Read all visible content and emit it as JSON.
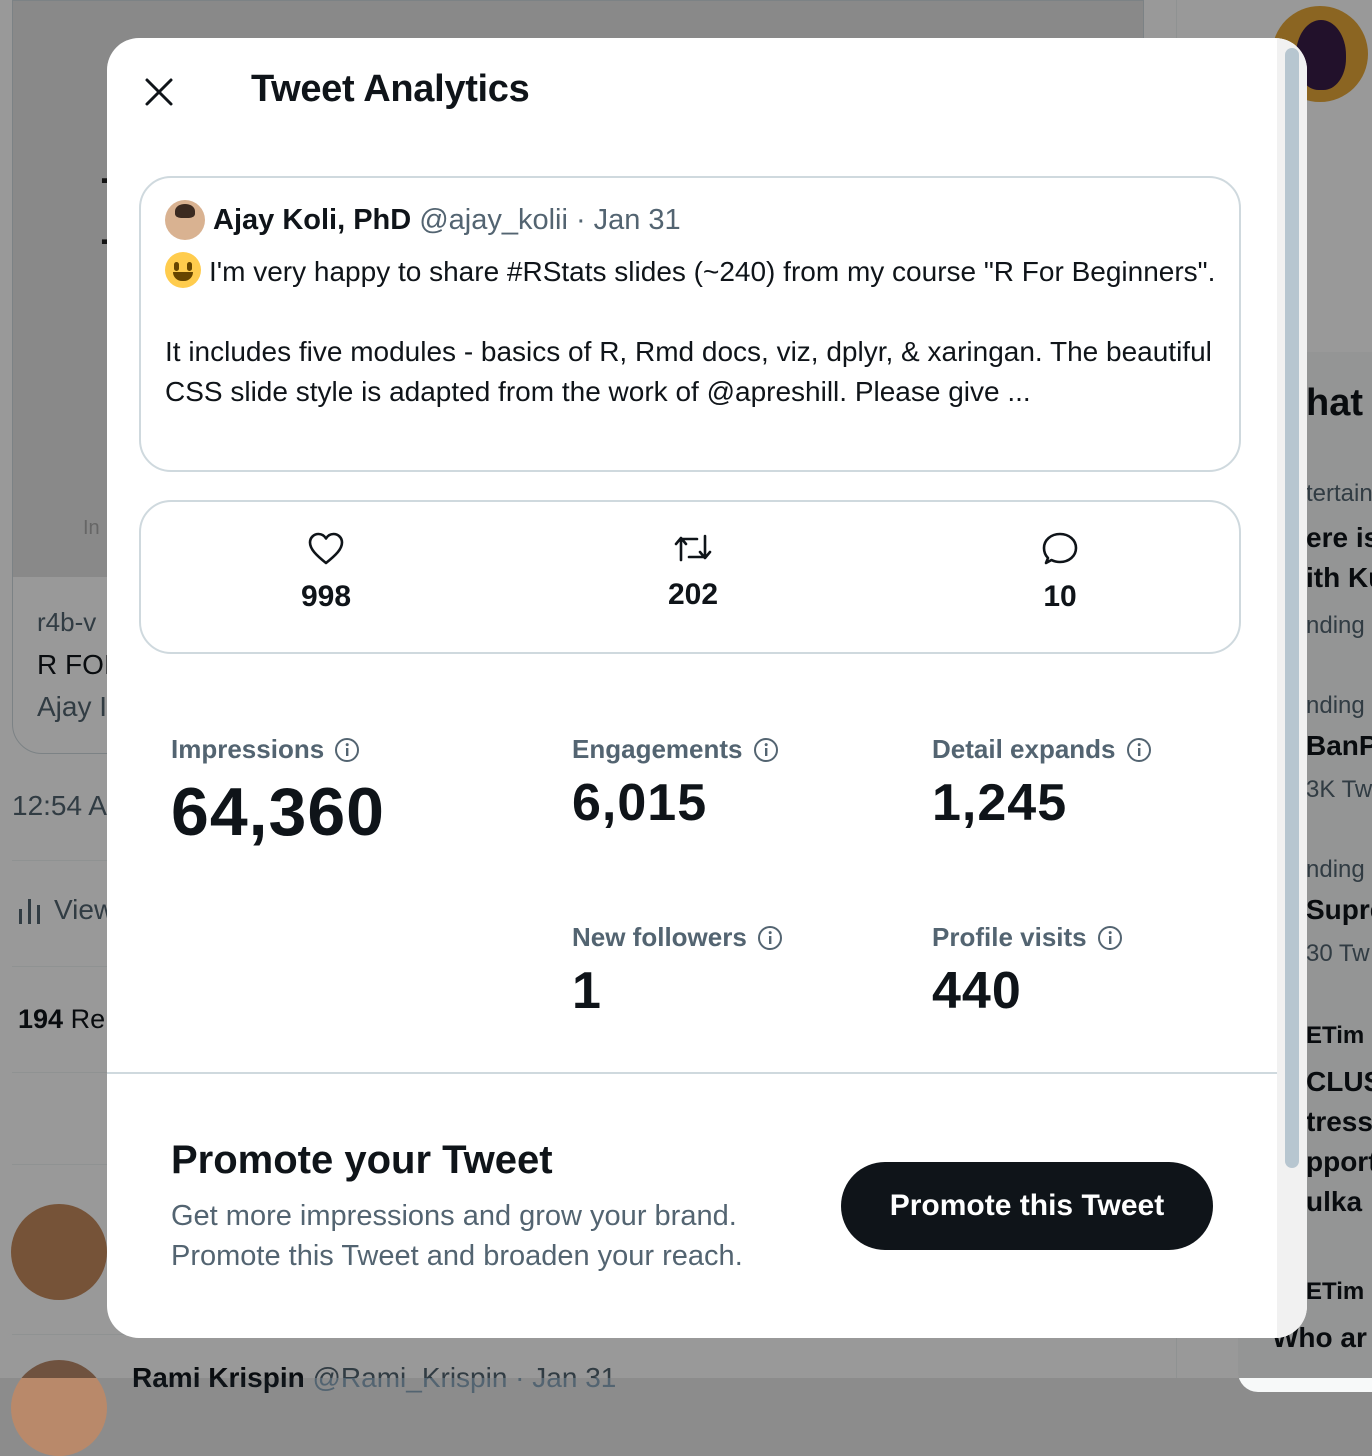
{
  "background": {
    "card": {
      "image_caption": "In",
      "image_letter": "I",
      "domain": "r4b-v",
      "title": "R FOI",
      "author": "Ajay I"
    },
    "timestamp": "12:54 A",
    "views_label": "View",
    "replies_count": "194",
    "replies_label": "Re",
    "reply_author": "Rami Krispin",
    "reply_handle_date": "@Rami_Krispin · Jan 31",
    "trends": [
      "hat",
      "tertain",
      "ere is",
      "ith Ku",
      "nding",
      "nding",
      "BanPl",
      "3K Tw",
      "nding",
      "Supre",
      "30 Tw",
      "ETim",
      "CLUS",
      "tress",
      "pport",
      "ulka",
      "ETim",
      "Who ar"
    ]
  },
  "modal": {
    "title": "Tweet Analytics",
    "close_icon": "close-icon",
    "tweet": {
      "author": "Ajay Koli, PhD",
      "handle": "@ajay_kolii",
      "separator": "·",
      "date": "Jan 31",
      "emoji": "grinning-face-emoji",
      "text": "I'm very happy to share #RStats slides (~240) from my course \"R For Beginners\".\n\nIt includes five modules - basics of R, Rmd docs, viz, dplyr, & xaringan. The beautiful CSS slide style is adapted from the work of @apreshill. Please give ..."
    },
    "stats": {
      "likes": {
        "icon": "heart-icon",
        "value": "998"
      },
      "retweets": {
        "icon": "retweet-icon",
        "value": "202"
      },
      "replies": {
        "icon": "reply-icon",
        "value": "10"
      }
    },
    "metrics": {
      "impressions": {
        "label": "Impressions",
        "value": "64,360"
      },
      "engagements": {
        "label": "Engagements",
        "value": "6,015"
      },
      "detail_expands": {
        "label": "Detail expands",
        "value": "1,245"
      },
      "new_followers": {
        "label": "New followers",
        "value": "1"
      },
      "profile_visits": {
        "label": "Profile visits",
        "value": "440"
      }
    },
    "promote": {
      "title": "Promote your Tweet",
      "line1": "Get more impressions and grow your brand.",
      "line2": "Promote this Tweet and broaden your reach.",
      "button": "Promote this Tweet"
    }
  },
  "colors": {
    "text_primary": "#0f1419",
    "text_secondary": "#536471",
    "border": "#cfd9de",
    "button_bg": "#0f1419",
    "button_text": "#ffffff",
    "scrollbar_thumb": "#b7c6d0",
    "emoji_yellow": "#ffcc4d"
  }
}
